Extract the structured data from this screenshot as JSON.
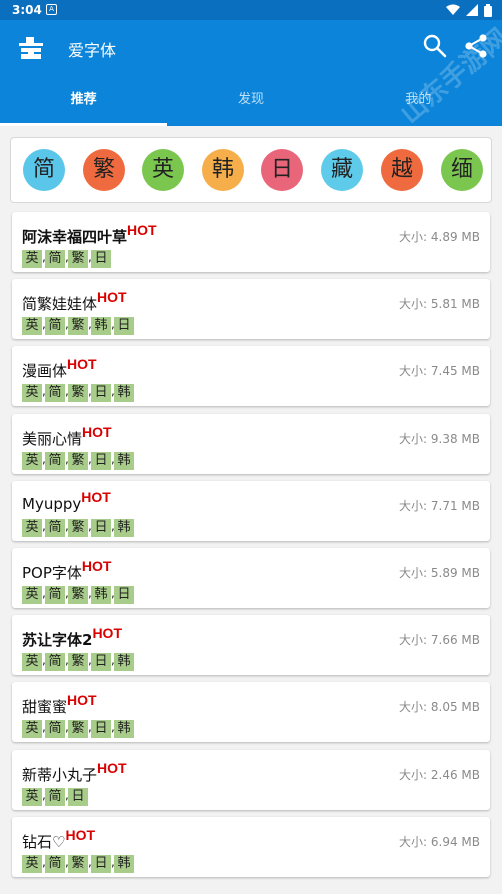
{
  "status_bar": {
    "time": "3:04",
    "notif_letter": "A"
  },
  "app_bar": {
    "title": "爱字体",
    "watermark": "山东手游网"
  },
  "tabs": [
    {
      "label": "推荐",
      "active": true
    },
    {
      "label": "发现",
      "active": false
    },
    {
      "label": "我的",
      "active": false
    }
  ],
  "languages": [
    {
      "char": "简",
      "color": "#59c6ea"
    },
    {
      "char": "繁",
      "color": "#ef6b3f"
    },
    {
      "char": "英",
      "color": "#7bc64f"
    },
    {
      "char": "韩",
      "color": "#f6ae4b"
    },
    {
      "char": "日",
      "color": "#e9657a"
    },
    {
      "char": "藏",
      "color": "#5fcbea"
    },
    {
      "char": "越",
      "color": "#ef6b3f"
    },
    {
      "char": "缅",
      "color": "#7bc64f"
    }
  ],
  "font_list": [
    {
      "name": "阿沫幸福四叶草",
      "hot": "HOT",
      "size": "大小: 4.89 MB",
      "tags": [
        "英",
        "简",
        "繁",
        "日"
      ]
    },
    {
      "name": "简繁娃娃体",
      "hot": "HOT",
      "size": "大小: 5.81 MB",
      "tags": [
        "英",
        "简",
        "繁",
        "韩",
        "日"
      ]
    },
    {
      "name": "漫画体",
      "hot": "HOT",
      "size": "大小: 7.45 MB",
      "tags": [
        "英",
        "简",
        "繁",
        "日",
        "韩"
      ]
    },
    {
      "name": "美丽心情",
      "hot": "HOT",
      "size": "大小: 9.38 MB",
      "tags": [
        "英",
        "简",
        "繁",
        "日",
        "韩"
      ]
    },
    {
      "name": "Myuppy",
      "hot": "HOT",
      "size": "大小: 7.71 MB",
      "tags": [
        "英",
        "简",
        "繁",
        "日",
        "韩"
      ]
    },
    {
      "name": "POP字体",
      "hot": "HOT",
      "size": "大小: 5.89 MB",
      "tags": [
        "英",
        "简",
        "繁",
        "韩",
        "日"
      ]
    },
    {
      "name": "苏让字体2",
      "hot": "HOT",
      "size": "大小: 7.66 MB",
      "tags": [
        "英",
        "简",
        "繁",
        "日",
        "韩"
      ]
    },
    {
      "name": "甜蜜蜜",
      "hot": "HOT",
      "size": "大小: 8.05 MB",
      "tags": [
        "英",
        "简",
        "繁",
        "日",
        "韩"
      ]
    },
    {
      "name": "新蒂小丸子",
      "hot": "HOT",
      "size": "大小: 2.46 MB",
      "tags": [
        "英",
        "简",
        "日"
      ]
    },
    {
      "name": "钻石♡",
      "hot": "HOT",
      "size": "大小: 6.94 MB",
      "tags": [
        "英",
        "简",
        "繁",
        "日",
        "韩"
      ]
    }
  ],
  "icons": {
    "logo": "hat-toolbox-icon",
    "search": "search-icon",
    "share": "share-icon",
    "wifi": "wifi-icon",
    "signal": "signal-icon",
    "battery": "battery-icon"
  },
  "colors": {
    "app_bar": "#0b84d9",
    "status_bar": "#0b6fc0",
    "hot": "#d90000",
    "tag": "#a8cc8a"
  }
}
